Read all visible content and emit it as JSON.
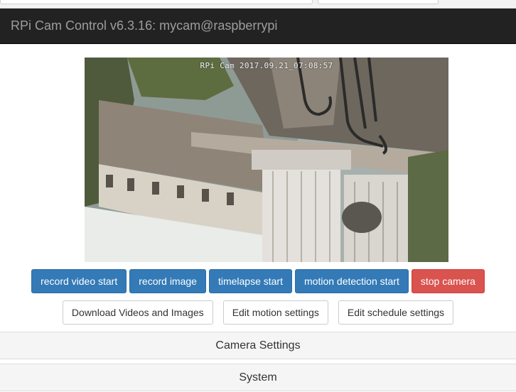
{
  "navbar": {
    "title": "RPi Cam Control v6.3.16: mycam@raspberrypi"
  },
  "preview": {
    "timestamp": "RPi Cam 2017.09.21_07:08:57"
  },
  "controls": {
    "record_video": "record video start",
    "record_image": "record image",
    "timelapse": "timelapse start",
    "motion_detection": "motion detection start",
    "stop_camera": "stop camera"
  },
  "links": {
    "download": "Download Videos and Images",
    "edit_motion": "Edit motion settings",
    "edit_schedule": "Edit schedule settings"
  },
  "panels": [
    {
      "label": "Camera Settings"
    },
    {
      "label": "System"
    }
  ],
  "colors": {
    "navbar": "#222222",
    "primary": "#337ab7",
    "danger": "#d9534f"
  }
}
